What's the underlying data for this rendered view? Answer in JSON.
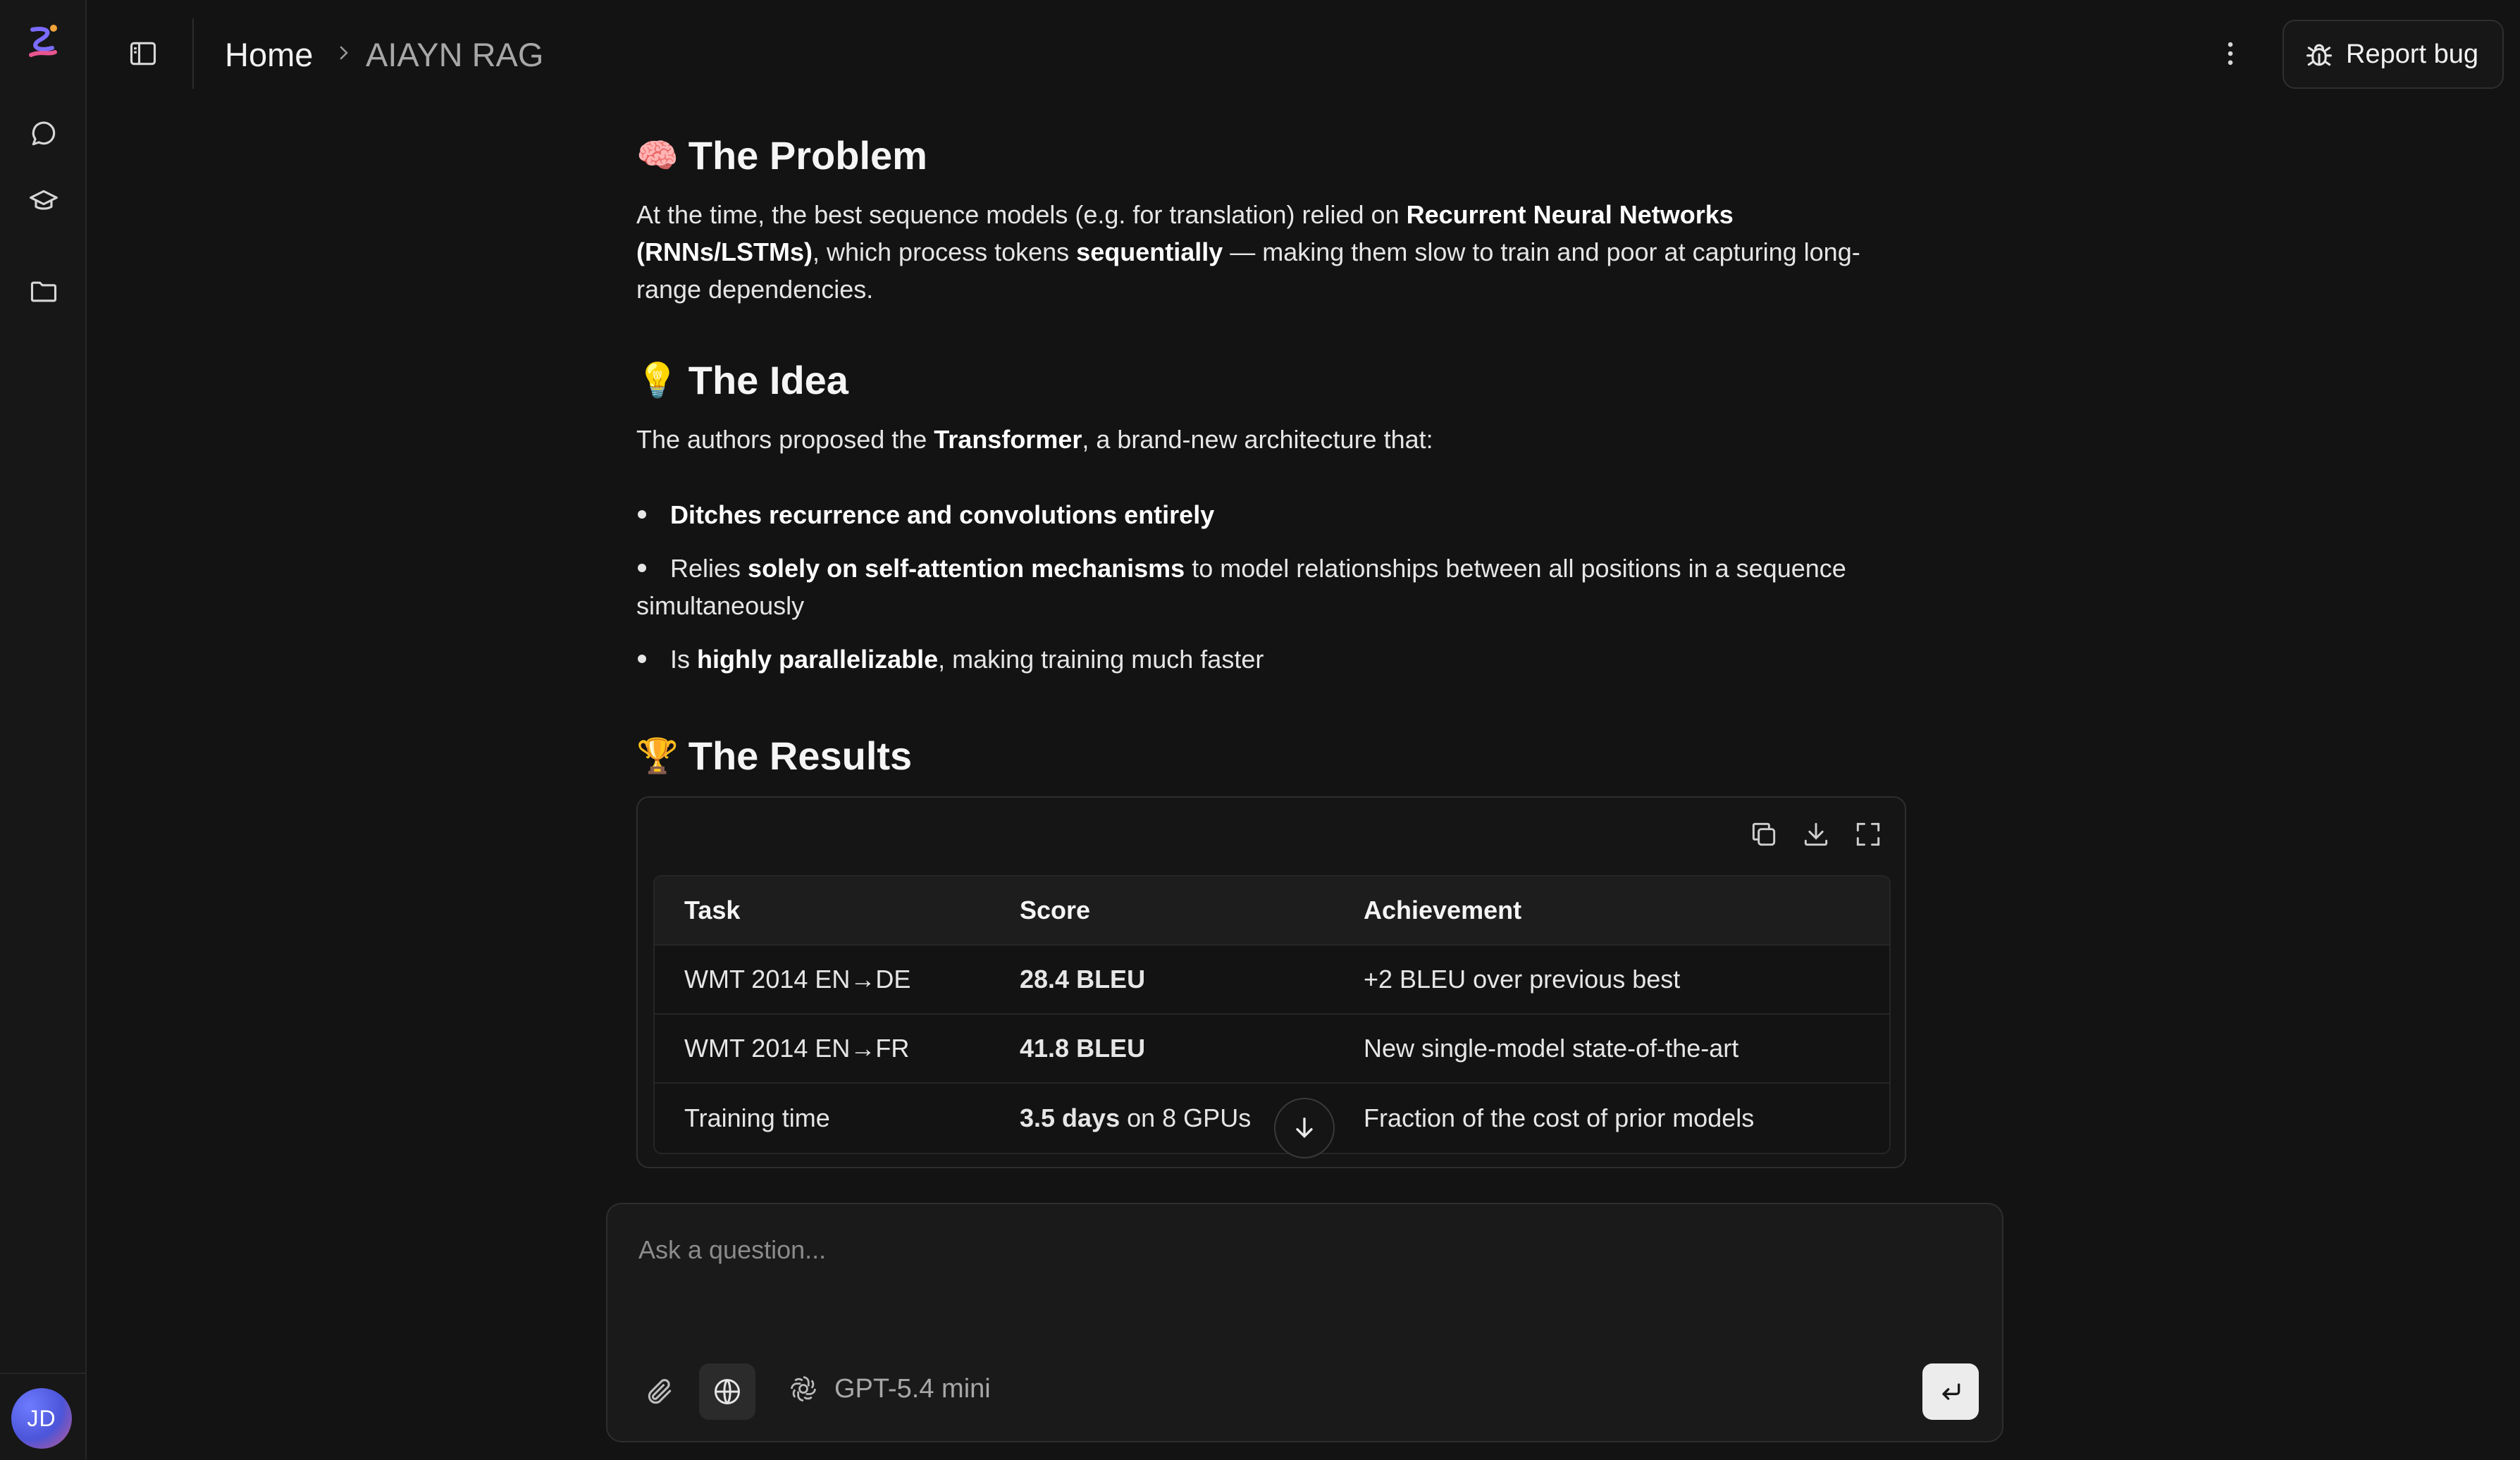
{
  "header": {
    "breadcrumb": {
      "home": "Home",
      "current": "AIAYN RAG"
    },
    "report_bug_label": "Report bug"
  },
  "user": {
    "initials": "JD"
  },
  "article": {
    "problem": {
      "emoji": "🧠",
      "heading": "The Problem",
      "text_1": "At the time, the best sequence models (e.g. for translation) relied on ",
      "bold_1": "Recurrent Neural Networks (RNNs/LSTMs)",
      "text_2": ", which process tokens ",
      "bold_2": "sequentially",
      "text_3": " — making them slow to train and poor at capturing long-range dependencies."
    },
    "idea": {
      "emoji": "💡",
      "heading": "The Idea",
      "intro_1": "The authors proposed the ",
      "intro_bold": "Transformer",
      "intro_2": ", a brand-new architecture that:",
      "bullets": [
        {
          "pre": "",
          "bold": "Ditches recurrence and convolutions entirely",
          "post": ""
        },
        {
          "pre": "Relies ",
          "bold": "solely on self-attention mechanisms",
          "post": " to model relationships between all positions in a sequence simultaneously"
        },
        {
          "pre": "Is ",
          "bold": "highly parallelizable",
          "post": ", making training much faster"
        }
      ]
    },
    "results": {
      "emoji": "🏆",
      "heading": "The Results",
      "columns": [
        "Task",
        "Score",
        "Achievement"
      ],
      "rows": [
        {
          "task": "WMT 2014 EN→DE",
          "score_bold": "28.4 BLEU",
          "score_rest": "",
          "achievement": "+2 BLEU over previous best"
        },
        {
          "task": "WMT 2014 EN→FR",
          "score_bold": "41.8 BLEU",
          "score_rest": "",
          "achievement": "New single-model state-of-the-art"
        },
        {
          "task": "Training time",
          "score_bold": "3.5 days",
          "score_rest": " on 8 GPUs",
          "achievement": "Fraction of the cost of prior models"
        }
      ]
    }
  },
  "composer": {
    "placeholder": "Ask a question...",
    "model": "GPT-5.4 mini"
  }
}
